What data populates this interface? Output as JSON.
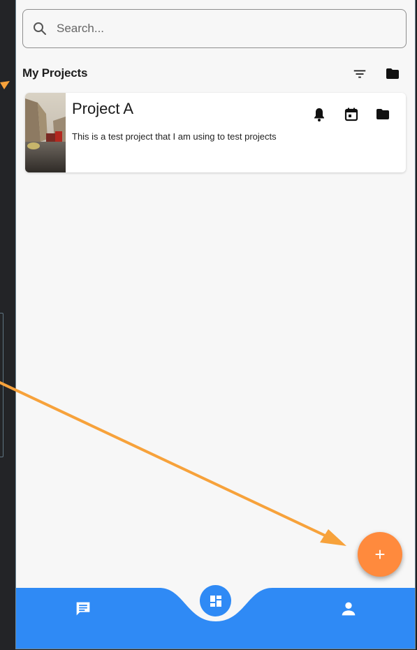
{
  "search": {
    "placeholder": "Search...",
    "value": ""
  },
  "header": {
    "title": "My Projects"
  },
  "projects": [
    {
      "title": "Project A",
      "description": "This is a test project that I am using to test projects",
      "icons": [
        "bell-icon",
        "calendar-icon",
        "folder-icon"
      ]
    }
  ],
  "fab": {
    "label": "+"
  },
  "bottom_nav": {
    "items": [
      "chat-icon",
      "dashboard-icon",
      "person-icon"
    ],
    "color": "#2f8af5"
  },
  "colors": {
    "accent": "#ff8a3d",
    "nav": "#2f8af5",
    "annotation_arrow": "#f7a23b"
  }
}
